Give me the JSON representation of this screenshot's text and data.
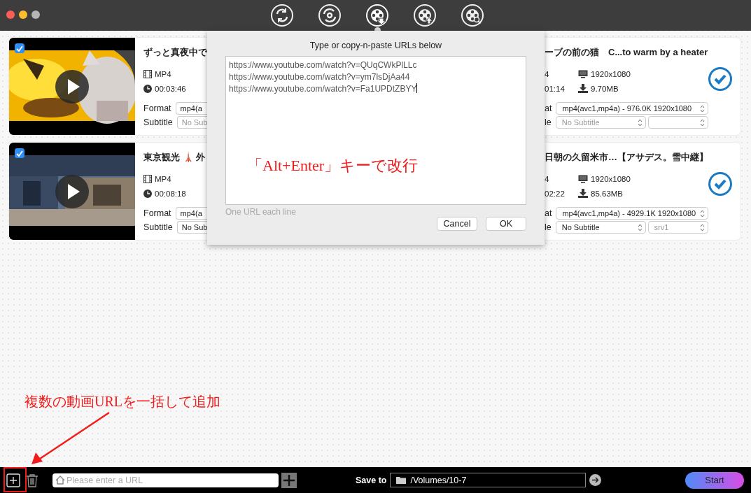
{
  "toolbar": {
    "tabs": [
      {
        "kind": "rotate",
        "selected": false
      },
      {
        "kind": "rotate-dot",
        "selected": false
      },
      {
        "kind": "reel-down",
        "selected": true
      },
      {
        "kind": "reel-up",
        "selected": false
      },
      {
        "kind": "reel-search",
        "selected": false
      }
    ]
  },
  "videos": [
    {
      "checked": true,
      "title_start": "ずっと真夜中で",
      "type": "MP4",
      "duration": "00:03:46",
      "format_label": "Format",
      "format_start": "mp4(a",
      "subtitle_label": "Subtitle",
      "subtitle_start": "No Sub",
      "title_end": "ーブの前の猫　C...to warm by a heater",
      "type_end": "4",
      "duration_end": "01:14",
      "resolution": "1920x1080",
      "size": "9.70MB",
      "format_label_end": "at",
      "format_value": "mp4(avc1,mp4a) - 976.0K 1920x1080",
      "subtitle_label_end": "le",
      "subtitle_value": "No Subtitle",
      "subtitle_disabled": true,
      "selected": true
    },
    {
      "checked": true,
      "title_start": "東京観光 🗼 外",
      "type": "MP4",
      "duration": "00:08:18",
      "format_label": "Format",
      "format_start": "mp4(a",
      "subtitle_label": "Subtitle",
      "subtitle_start": "No Sub",
      "title_end": "日朝の久留米市…【アサデス。雪中継】",
      "type_end": "4",
      "duration_end": "02:22",
      "resolution": "1920x1080",
      "size": "85.63MB",
      "format_label_end": "at",
      "format_value": "mp4(avc1,mp4a) - 4929.1K 1920x1080",
      "subtitle_label_end": "le",
      "subtitle_value": "No Subtitle",
      "subtitle_track": "srv1",
      "subtitle_disabled": false,
      "selected": true
    }
  ],
  "dialog": {
    "title": "Type or copy-n-paste URLs below",
    "lines": [
      "https://www.youtube.com/watch?v=QUqCWkPlLLc",
      "https://www.youtube.com/watch?v=ym7lsDjAa44",
      "https://www.youtube.com/watch?v=Fa1UPDtZBYY"
    ],
    "note": "「Alt+Enter」キーで改行",
    "hint": "One URL each line",
    "buttons": [
      "Cancel",
      "OK"
    ]
  },
  "annotation": {
    "text": "複数の動画URLを一括して追加"
  },
  "bottom_bar": {
    "url_placeholder": "Please enter a URL",
    "save_label": "Save to",
    "save_path": "/Volumes/10-7",
    "start": "Start"
  }
}
